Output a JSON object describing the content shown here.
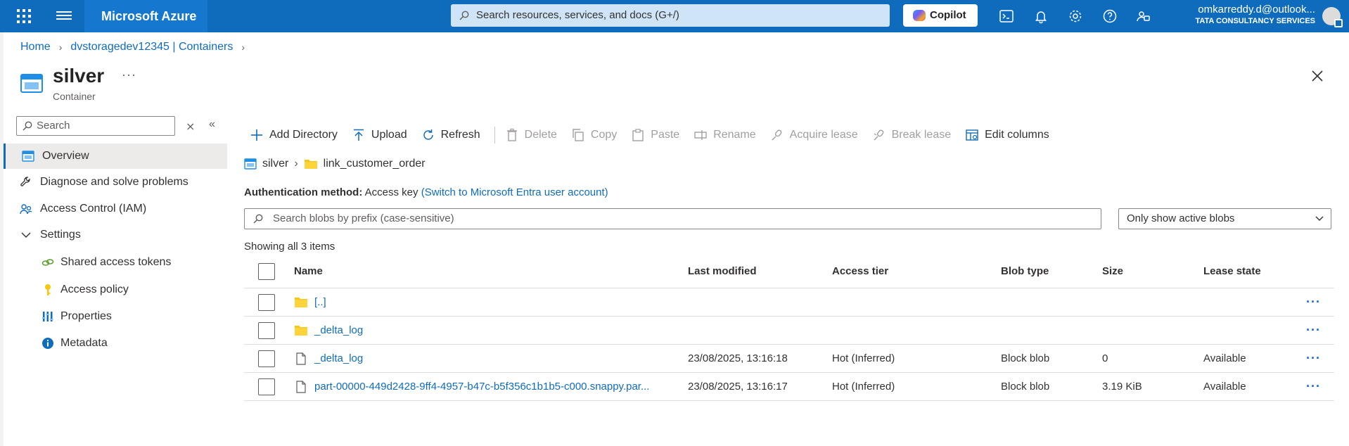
{
  "topbar": {
    "brand": "Microsoft Azure",
    "search_placeholder": "Search resources, services, and docs (G+/)",
    "copilot_label": "Copilot",
    "account_user": "omkarreddy.d@outlook...",
    "account_org": "TATA CONSULTANCY SERVICES"
  },
  "breadcrumb": {
    "home": "Home",
    "parent": "dvstoragedev12345 | Containers"
  },
  "header": {
    "title": "silver",
    "subtitle": "Container",
    "more": "···"
  },
  "nav": {
    "search_placeholder": "Search",
    "items": [
      {
        "label": "Overview"
      },
      {
        "label": "Diagnose and solve problems"
      },
      {
        "label": "Access Control (IAM)"
      },
      {
        "label": "Settings"
      },
      {
        "label": "Shared access tokens"
      },
      {
        "label": "Access policy"
      },
      {
        "label": "Properties"
      },
      {
        "label": "Metadata"
      }
    ]
  },
  "toolbar": {
    "add_directory": "Add Directory",
    "upload": "Upload",
    "refresh": "Refresh",
    "delete": "Delete",
    "copy": "Copy",
    "paste": "Paste",
    "rename": "Rename",
    "acquire_lease": "Acquire lease",
    "break_lease": "Break lease",
    "edit_columns": "Edit columns"
  },
  "path": {
    "root": "silver",
    "folder": "link_customer_order"
  },
  "auth": {
    "label": "Authentication method:",
    "value": "Access key",
    "switch_link": "(Switch to Microsoft Entra user account)"
  },
  "blob_search_placeholder": "Search blobs by prefix (case-sensitive)",
  "filter_value": "Only show active blobs",
  "showing": "Showing all 3 items",
  "table": {
    "headers": {
      "name": "Name",
      "modified": "Last modified",
      "tier": "Access tier",
      "type": "Blob type",
      "size": "Size",
      "lease": "Lease state"
    },
    "rows": [
      {
        "name": "[..]",
        "modified": "",
        "tier": "",
        "type": "",
        "size": "",
        "lease": "",
        "kind": "folder"
      },
      {
        "name": "_delta_log",
        "modified": "",
        "tier": "",
        "type": "",
        "size": "",
        "lease": "",
        "kind": "folder"
      },
      {
        "name": "_delta_log",
        "modified": "23/08/2025, 13:16:18",
        "tier": "Hot (Inferred)",
        "type": "Block blob",
        "size": "0",
        "lease": "Available",
        "kind": "file"
      },
      {
        "name": "part-00000-449d2428-9ff4-4957-b47c-b5f356c1b1b5-c000.snappy.par...",
        "modified": "23/08/2025, 13:16:17",
        "tier": "Hot (Inferred)",
        "type": "Block blob",
        "size": "3.19 KiB",
        "lease": "Available",
        "kind": "file"
      }
    ],
    "row_more": "···"
  },
  "colors": {
    "brand": "#0f6cbd",
    "folder": "#f2c811"
  }
}
